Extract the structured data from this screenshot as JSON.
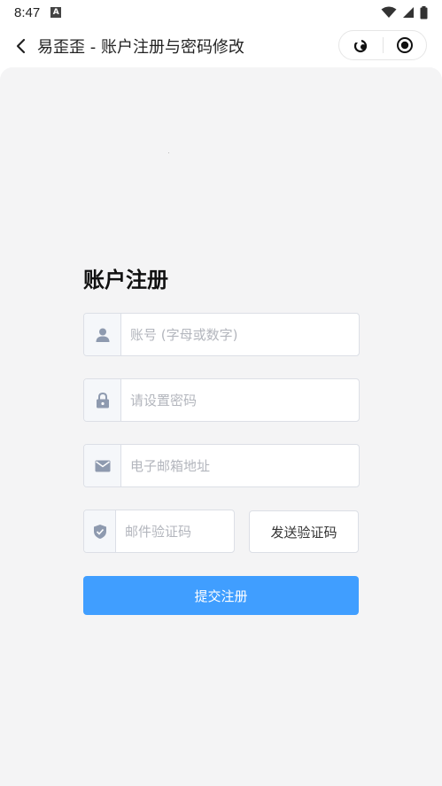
{
  "status_bar": {
    "time": "8:47",
    "notification_icon": "A"
  },
  "nav": {
    "title": "易歪歪 - 账户注册与密码修改"
  },
  "form": {
    "title": "账户注册",
    "account_placeholder": "账号 (字母或数字)",
    "password_placeholder": "请设置密码",
    "email_placeholder": "电子邮箱地址",
    "code_placeholder": "邮件验证码",
    "send_code_label": "发送验证码",
    "submit_label": "提交注册"
  },
  "colors": {
    "primary": "#409eff",
    "background": "#f4f4f5",
    "icon": "#8e9aaf"
  }
}
